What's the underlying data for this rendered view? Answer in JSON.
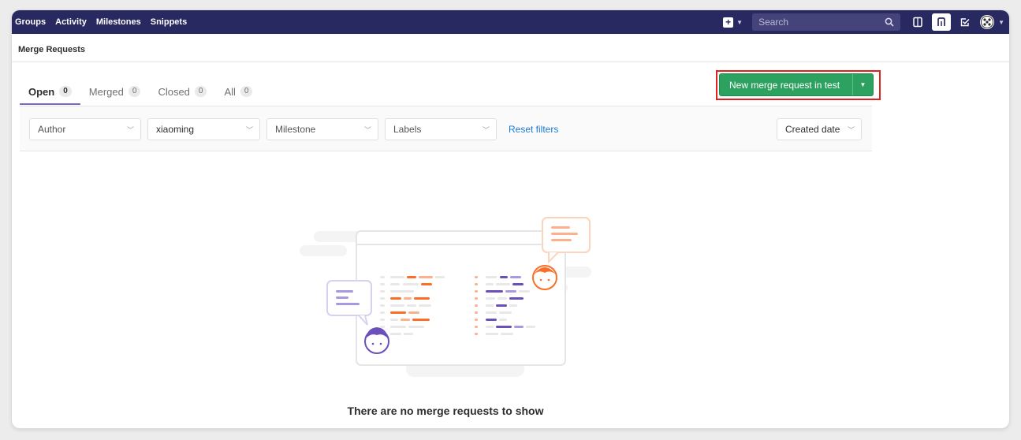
{
  "navbar": {
    "links": [
      "Groups",
      "Activity",
      "Milestones",
      "Snippets"
    ],
    "search_placeholder": "Search"
  },
  "breadcrumb": "Merge Requests",
  "tabs": [
    {
      "label": "Open",
      "count": "0"
    },
    {
      "label": "Merged",
      "count": "0"
    },
    {
      "label": "Closed",
      "count": "0"
    },
    {
      "label": "All",
      "count": "0"
    }
  ],
  "new_mr_button": {
    "label": "New merge request in test"
  },
  "filters": {
    "author": "Author",
    "assignee": "xiaoming",
    "milestone": "Milestone",
    "labels": "Labels",
    "reset": "Reset filters",
    "sort": "Created date"
  },
  "empty_state": {
    "message": "There are no merge requests to show"
  },
  "colors": {
    "navbar": "#292961",
    "accent": "#7b68c8",
    "primary_button": "#2da160",
    "highlight_outline": "#e0201b",
    "link": "#1f78d1"
  }
}
